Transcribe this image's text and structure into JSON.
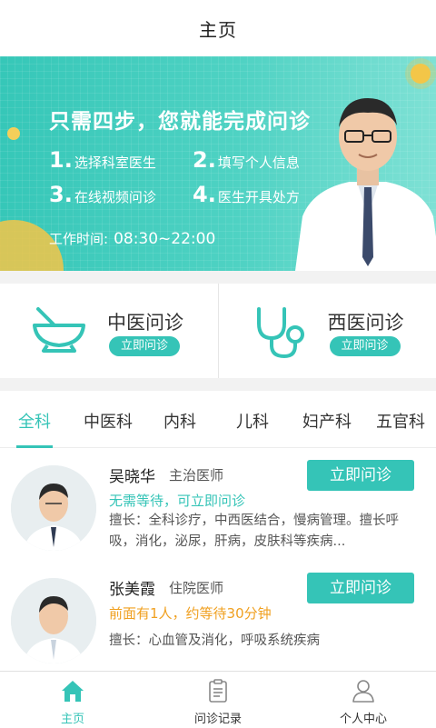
{
  "header": {
    "title": "主页"
  },
  "banner": {
    "headline": "只需四步，您就能完成问诊",
    "steps": [
      {
        "num": "1.",
        "text": "选择科室医生"
      },
      {
        "num": "2.",
        "text": "填写个人信息"
      },
      {
        "num": "3.",
        "text": "在线视频问诊"
      },
      {
        "num": "4.",
        "text": "医生开具处方"
      }
    ],
    "hours_label": "工作时间:",
    "hours_value": "08:30~22:00",
    "colors": {
      "bg": "#36c7b8",
      "sun": "#f3c648"
    }
  },
  "consult": {
    "tcm": {
      "name": "中医问诊",
      "button": "立即问诊",
      "icon": "mortar-bowl-icon"
    },
    "western": {
      "name": "西医问诊",
      "button": "立即问诊",
      "icon": "stethoscope-icon"
    }
  },
  "departments": {
    "tabs": [
      "全科",
      "中医科",
      "内科",
      "儿科",
      "妇产科",
      "五官科"
    ],
    "active_index": 0
  },
  "doctors": [
    {
      "name": "吴晓华",
      "title": "主治医师",
      "status": "无需等待，可立即问诊",
      "status_color": "#35c4b7",
      "desc": "擅长：全科诊疗，中西医结合，慢病管理。擅长呼吸，消化，泌尿，肝病，皮肤科等疾病...",
      "button": "立即问诊"
    },
    {
      "name": "张美霞",
      "title": "住院医师",
      "status": "前面有1人，约等待30分钟",
      "status_color": "#f0a020",
      "desc": "擅长：心血管及消化，呼吸系统疾病",
      "button": "立即问诊"
    }
  ],
  "tabbar": {
    "items": [
      {
        "label": "主页",
        "icon": "home-icon",
        "active": true
      },
      {
        "label": "问诊记录",
        "icon": "clipboard-icon",
        "active": false
      },
      {
        "label": "个人中心",
        "icon": "person-icon",
        "active": false
      }
    ]
  },
  "accent": "#35c4b7"
}
